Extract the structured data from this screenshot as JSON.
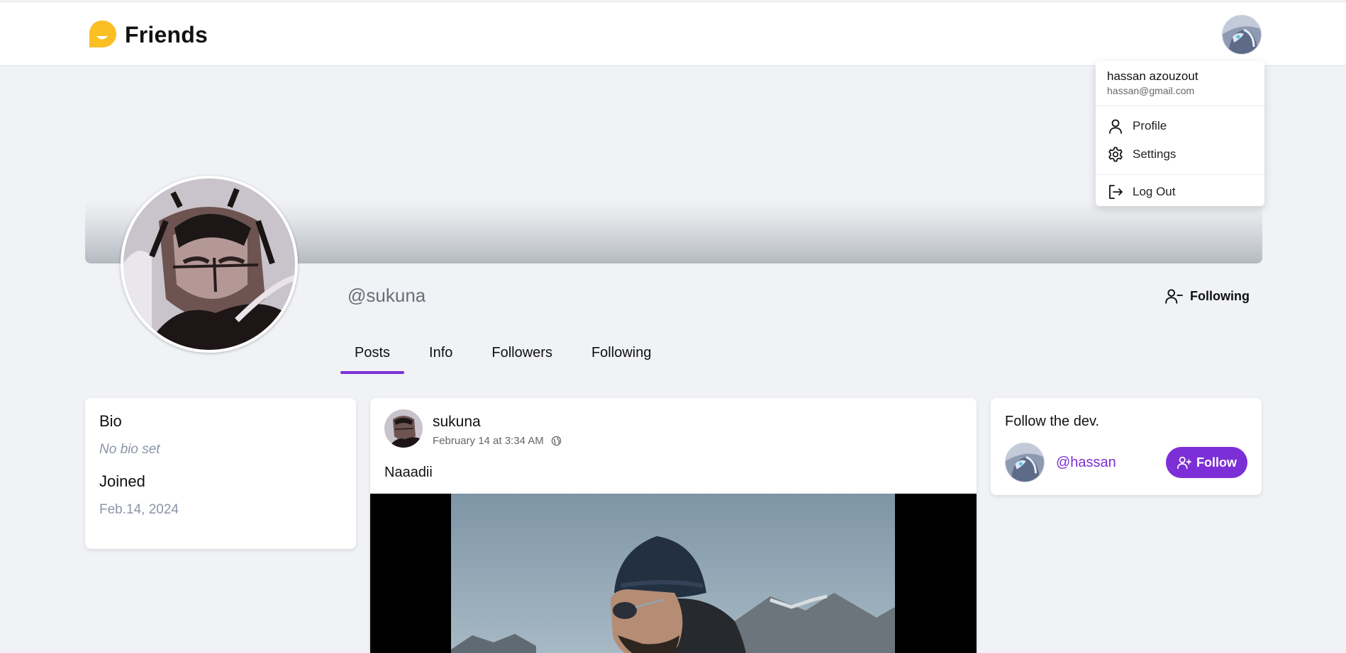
{
  "header": {
    "app_name": "Friends",
    "logo_color": "#fbbf24"
  },
  "dropdown": {
    "user_name": "hassan azouzout",
    "user_email": "hassan@gmail.com",
    "items": [
      {
        "label": "Profile",
        "icon": "user-icon"
      },
      {
        "label": "Settings",
        "icon": "gear-icon"
      },
      {
        "label": "Log Out",
        "icon": "logout-icon"
      }
    ]
  },
  "profile": {
    "username": "@sukuna",
    "following_label": "Following"
  },
  "tabs": [
    {
      "label": "Posts",
      "active": true
    },
    {
      "label": "Info",
      "active": false
    },
    {
      "label": "Followers",
      "active": false
    },
    {
      "label": "Following",
      "active": false
    }
  ],
  "bio": {
    "heading": "Bio",
    "value": "No bio set",
    "joined_heading": "Joined",
    "joined_date": "Feb.14, 2024"
  },
  "post": {
    "author": "sukuna",
    "timestamp": "February 14 at 3:34 AM",
    "visibility_icon": "globe-icon",
    "text": "Naaadii"
  },
  "follow_dev": {
    "title": "Follow the dev.",
    "handle": "@hassan",
    "button_label": "Follow"
  },
  "colors": {
    "accent": "#7c2fd6",
    "background": "#f0f2f6"
  }
}
